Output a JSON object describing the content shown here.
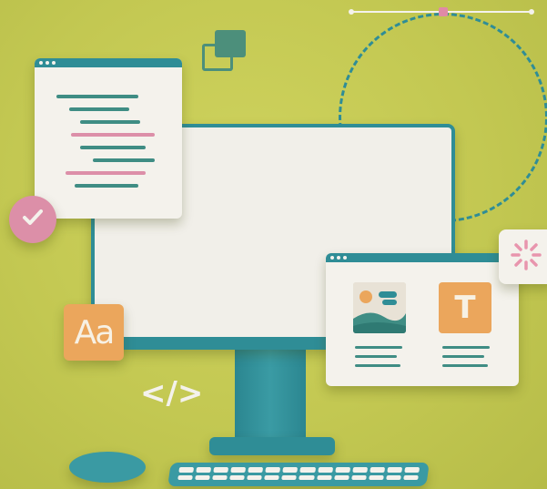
{
  "scene": {
    "title": "",
    "colors": {
      "background": "#c3c852",
      "teal": "#2f8d96",
      "cream": "#f4f2ec",
      "pink": "#dc8fa8",
      "orange": "#eba65c",
      "green": "#4c8f7b"
    }
  },
  "typography_card": {
    "label": "Aa"
  },
  "code_tag": {
    "label": "</>"
  },
  "media_window": {
    "text_card_label": "T"
  },
  "icons": {
    "check": "check-icon",
    "loading": "loading-spinner-icon",
    "image": "image-placeholder-icon"
  }
}
